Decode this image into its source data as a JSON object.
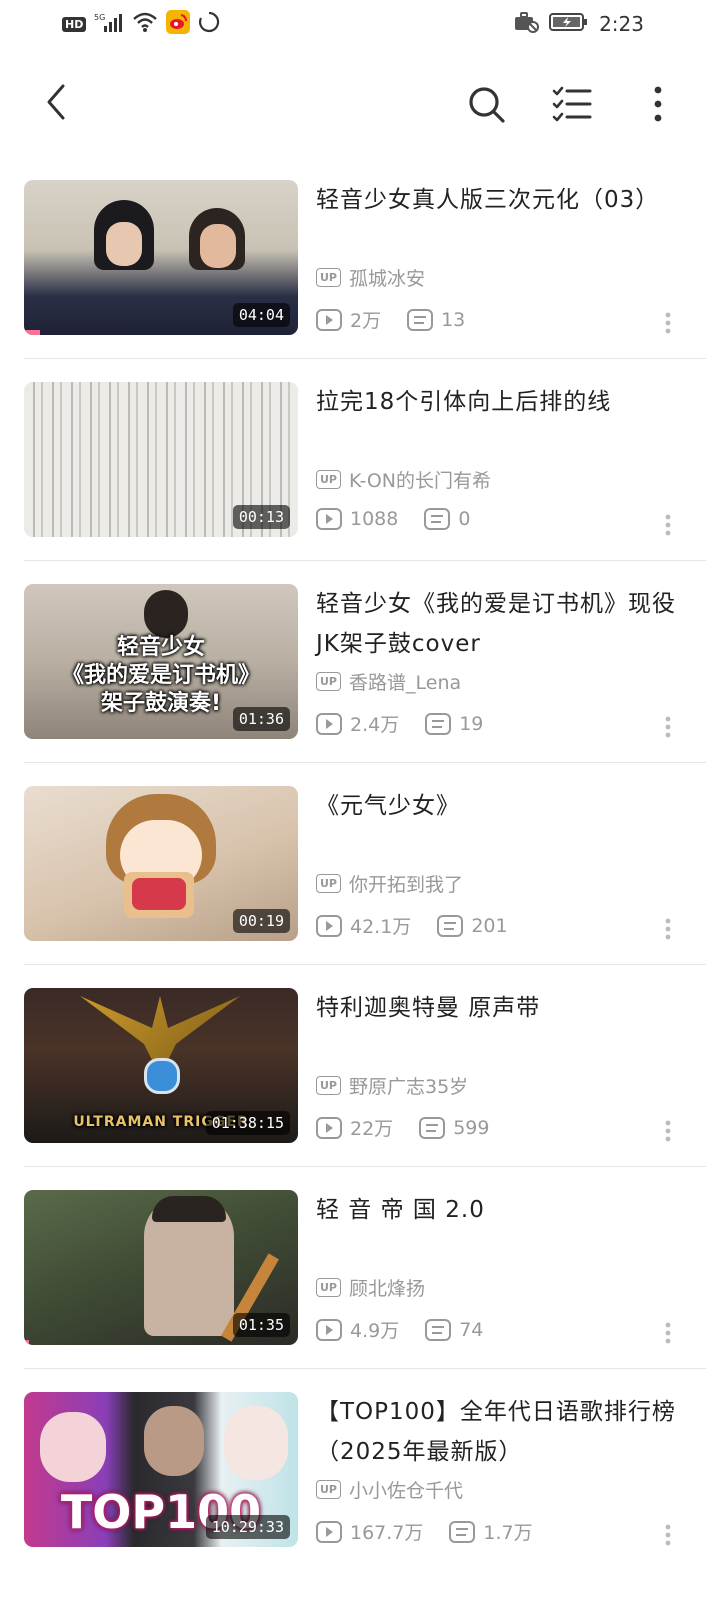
{
  "status_bar": {
    "network": "5G",
    "hd": "HD",
    "time": "2:23"
  },
  "videos": [
    {
      "title": "轻音少女真人版三次元化（03）",
      "uploader": "孤城冰安",
      "views": "2万",
      "danmaku": "13",
      "duration": "04:04",
      "progress": 0.06,
      "overlay": ""
    },
    {
      "title": "拉完18个引体向上后排的线",
      "uploader": "K-ON的长门有希",
      "views": "1088",
      "danmaku": "0",
      "duration": "00:13",
      "progress": 0,
      "overlay": ""
    },
    {
      "title": "轻音少女《我的爱是订书机》现役JK架子鼓cover",
      "uploader": "香路谱_Lena",
      "views": "2.4万",
      "danmaku": "19",
      "duration": "01:36",
      "progress": 0,
      "overlay": "轻音少女\n《我的爱是订书机》\n架子鼓演奏!"
    },
    {
      "title": "《元气少女》",
      "uploader": "你开拓到我了",
      "views": "42.1万",
      "danmaku": "201",
      "duration": "00:19",
      "progress": 0,
      "overlay": ""
    },
    {
      "title": "特利迦奥特曼 原声带",
      "uploader": "野原广志35岁",
      "views": "22万",
      "danmaku": "599",
      "duration": "01:38:15",
      "progress": 0,
      "overlay": "ULTRAMAN TRIGGER"
    },
    {
      "title": "轻 音 帝 国 2.0",
      "uploader": "顾北烽扬",
      "views": "4.9万",
      "danmaku": "74",
      "duration": "01:35",
      "progress": 0.02,
      "overlay": ""
    },
    {
      "title": "【TOP100】全年代日语歌排行榜（2025年最新版）",
      "uploader": "小小佐仓千代",
      "views": "167.7万",
      "danmaku": "1.7万",
      "duration": "10:29:33",
      "progress": 0,
      "overlay": "TOP100"
    }
  ],
  "labels": {
    "up_badge": "UP"
  },
  "icons": {
    "back": "chevron-left-icon",
    "search": "search-icon",
    "list": "checklist-icon",
    "more": "more-vertical-icon"
  },
  "colors": {
    "accent": "#fb7299",
    "muted": "#999999",
    "text": "#222222"
  }
}
